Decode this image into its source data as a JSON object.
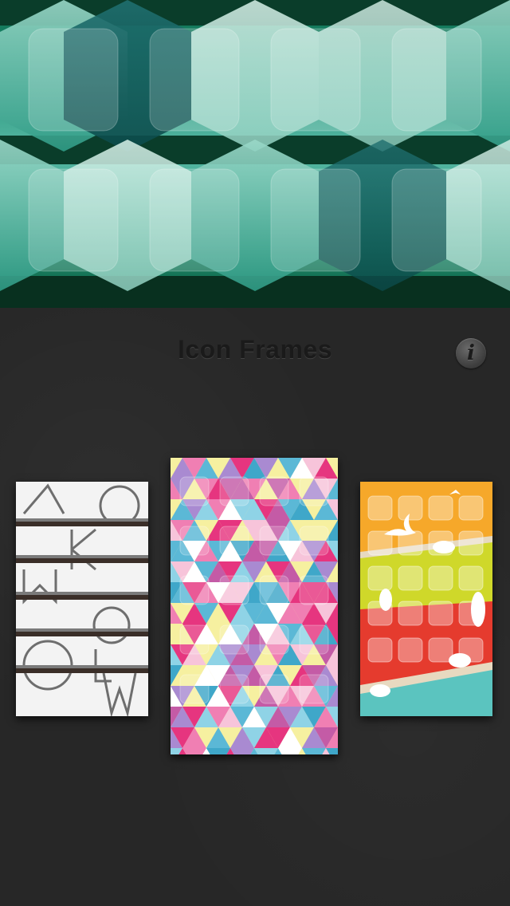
{
  "header": {
    "title": "Icon Frames",
    "info_icon": "info-icon",
    "info_glyph": "i"
  },
  "banner": {
    "description_icon": "hexagon-wallpaper-preview",
    "colors": [
      "#0a5b3e",
      "#1e8e72",
      "#57b9a5",
      "#b9e6d8",
      "#000000"
    ]
  },
  "frames": [
    {
      "name": "typography-letters",
      "accent": "#3b2f2a"
    },
    {
      "name": "triangle-mosaic",
      "accent": "#e6357f"
    },
    {
      "name": "birds-color-bands",
      "accent": "#f5a623"
    }
  ]
}
